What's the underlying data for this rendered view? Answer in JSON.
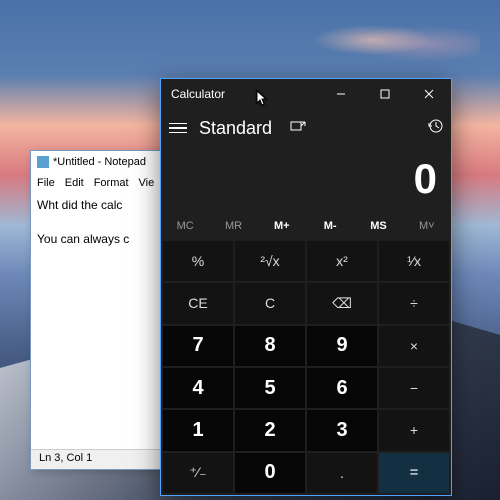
{
  "notepad": {
    "title": "*Untitled - Notepad",
    "menu": [
      "File",
      "Edit",
      "Format",
      "Vie"
    ],
    "text_line1": "Wht did the calc",
    "text_line2": "You can always c",
    "status": "Ln 3, Col 1"
  },
  "calculator": {
    "title": "Calculator",
    "mode": "Standard",
    "display": "0",
    "window_controls": {
      "min": "minimize",
      "max": "maximize",
      "close": "close"
    },
    "memory": {
      "mc": "MC",
      "mr": "MR",
      "mplus": "M+",
      "mminus": "M-",
      "ms": "MS",
      "mv": "M˅"
    },
    "keys": {
      "percent": "%",
      "sqrt": "²√x",
      "square": "x²",
      "recip": "¹⁄x",
      "ce": "CE",
      "c": "C",
      "back": "⌫",
      "div": "÷",
      "k7": "7",
      "k8": "8",
      "k9": "9",
      "mul": "×",
      "k4": "4",
      "k5": "5",
      "k6": "6",
      "sub": "−",
      "k1": "1",
      "k2": "2",
      "k3": "3",
      "add": "+",
      "neg": "⁺⁄₋",
      "k0": "0",
      "dot": ".",
      "eq": "="
    }
  }
}
